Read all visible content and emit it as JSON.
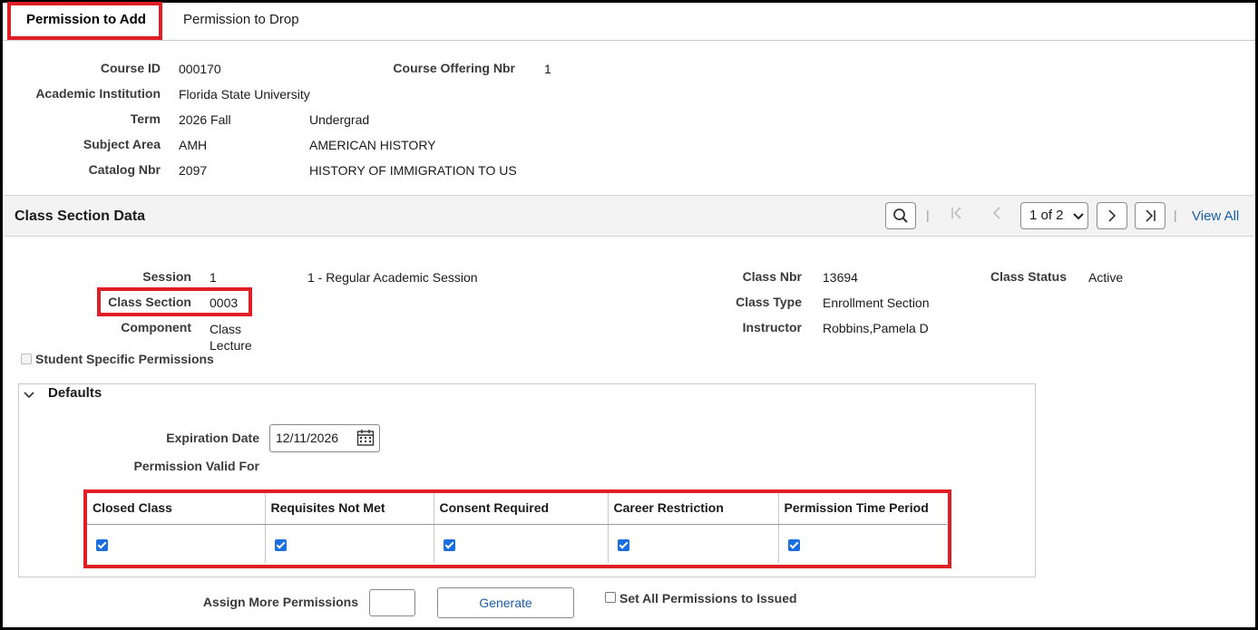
{
  "tabs": [
    {
      "label": "Permission to Add",
      "active": true
    },
    {
      "label": "Permission to Drop",
      "active": false
    }
  ],
  "course": {
    "course_id_label": "Course ID",
    "course_id": "000170",
    "offering_label": "Course Offering Nbr",
    "offering": "1",
    "institution_label": "Academic Institution",
    "institution": "Florida State University",
    "term_label": "Term",
    "term": "2026 Fall",
    "career": "Undergrad",
    "subject_label": "Subject Area",
    "subject_code": "AMH",
    "subject_name": "AMERICAN HISTORY",
    "catalog_label": "Catalog Nbr",
    "catalog": "2097",
    "catalog_title": "HISTORY OF IMMIGRATION TO US"
  },
  "section_header": {
    "title": "Class Section Data",
    "pager": "1 of 2",
    "view_all": "View All",
    "icons": [
      "search-icon",
      "first-page-icon",
      "previous-icon",
      "chevron-down-icon",
      "next-icon",
      "last-page-icon"
    ]
  },
  "class_section": {
    "session_label": "Session",
    "session": "1",
    "session_desc": "1 - Regular Academic Session",
    "class_nbr_label": "Class Nbr",
    "class_nbr": "13694",
    "status_label": "Class Status",
    "status": "Active",
    "section_label": "Class Section",
    "section": "0003",
    "type_label": "Class Type",
    "type": "Enrollment Section",
    "component_label": "Component",
    "component_line1": "Class",
    "component_line2": "Lecture",
    "instructor_label": "Instructor",
    "instructor": "Robbins,Pamela D",
    "student_specific_label": "Student Specific Permissions"
  },
  "defaults": {
    "title": "Defaults",
    "expiration_label": "Expiration Date",
    "expiration_value": "12/11/2026",
    "valid_for_label": "Permission Valid For",
    "columns": [
      "Closed Class",
      "Requisites Not Met",
      "Consent Required",
      "Career Restriction",
      "Permission Time Period"
    ],
    "checked": [
      true,
      true,
      true,
      true,
      true
    ]
  },
  "footer": {
    "assign_label": "Assign More Permissions",
    "assign_value": "",
    "generate_label": "Generate",
    "set_all_label": "Set All Permissions to Issued"
  },
  "colors": {
    "highlight": "#e01e25",
    "link": "#1a5fa8",
    "checkbox": "#1a6ee0"
  }
}
